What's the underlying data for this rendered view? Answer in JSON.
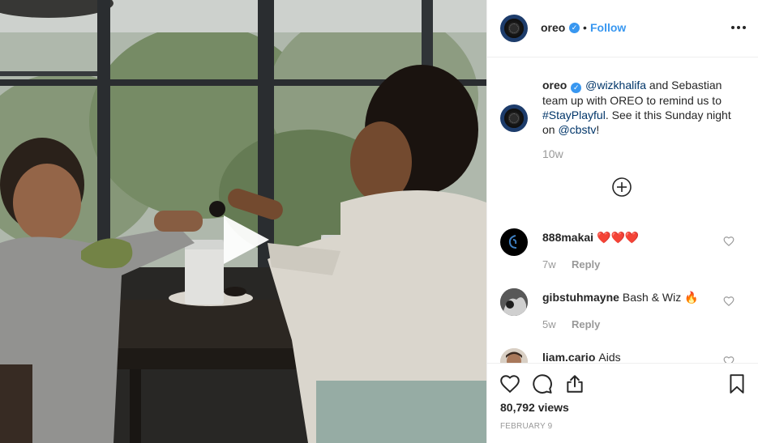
{
  "header": {
    "username": "oreo",
    "separator": "•",
    "follow_label": "Follow"
  },
  "caption": {
    "username": "oreo",
    "mention_1": "@wizkhalifa",
    "text_1": " and Sebastian team up with OREO to remind us to ",
    "hashtag": "#StayPlayful",
    "text_2": ". See it this Sunday night on ",
    "mention_2": "@cbstv",
    "text_3": "!",
    "time": "10w"
  },
  "comments": [
    {
      "username": "888makai",
      "text": "❤️❤️❤️",
      "time": "7w",
      "reply_label": "Reply"
    },
    {
      "username": "gibstuhmayne",
      "text": "Bash & Wiz 🔥",
      "time": "5w",
      "reply_label": "Reply"
    },
    {
      "username": "liam.cario",
      "text": "Aids",
      "time": "",
      "reply_label": ""
    }
  ],
  "stats": {
    "views": "80,792 views",
    "date": "FEBRUARY 9"
  },
  "icons": {
    "verified": "verified-badge-icon",
    "more": "more-options-icon",
    "load_more": "load-more-comments-icon",
    "like": "heart-icon",
    "comment": "comment-icon",
    "share": "share-icon",
    "save": "bookmark-icon",
    "play": "play-icon"
  },
  "colors": {
    "accent": "#3897f0",
    "link": "#003569",
    "muted": "#999999",
    "heart": "#ed4956"
  }
}
